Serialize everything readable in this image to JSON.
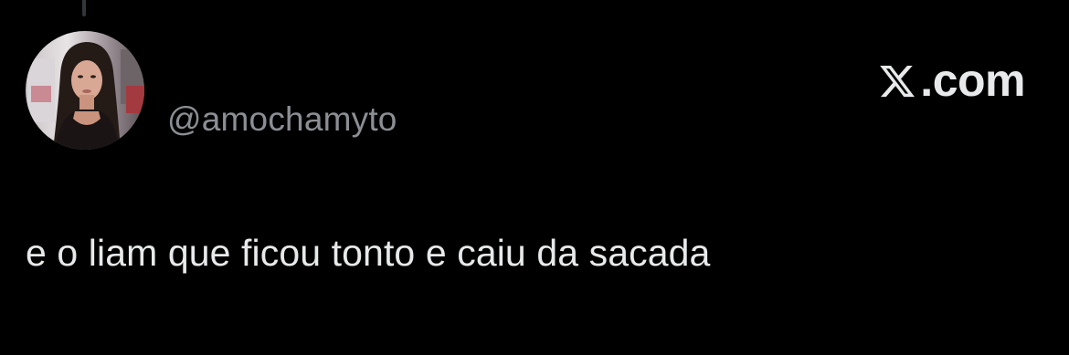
{
  "thread": {
    "connector_icon": "thread-line"
  },
  "author": {
    "avatar_icon": "profile-photo",
    "handle": "@amochamyto"
  },
  "brand": {
    "logo_icon": "x-logo-icon",
    "text": ".com"
  },
  "tweet": {
    "text": "e o liam que ficou tonto e caiu da sacada"
  },
  "colors": {
    "background": "#000000",
    "primary_text": "#e7e9ea",
    "secondary_text": "#8b8f94"
  }
}
